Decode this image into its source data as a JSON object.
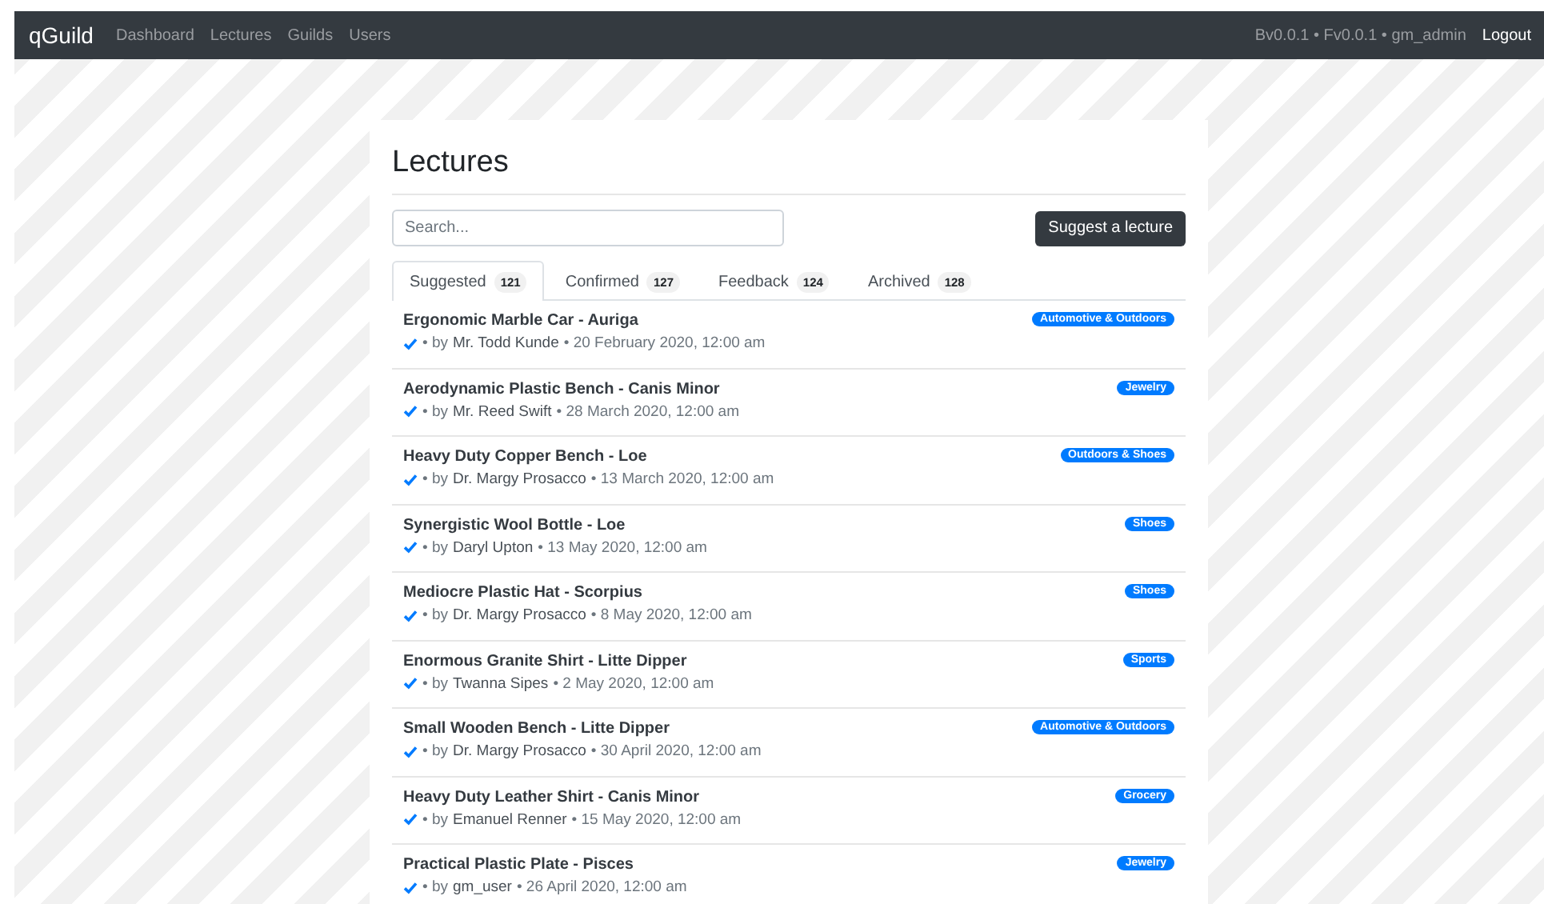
{
  "navbar": {
    "brand": "qGuild",
    "links": [
      "Dashboard",
      "Lectures",
      "Guilds",
      "Users"
    ],
    "version": "Bv0.0.1 • Fv0.0.1 • gm_admin",
    "logout": "Logout"
  },
  "page": {
    "title": "Lectures",
    "search": {
      "placeholder": "Search..."
    },
    "suggest_button": "Suggest a lecture",
    "tabs": [
      {
        "label": "Suggested",
        "count": "121",
        "selected": true
      },
      {
        "label": "Confirmed",
        "count": "127",
        "selected": false
      },
      {
        "label": "Feedback",
        "count": "124",
        "selected": false
      },
      {
        "label": "Archived",
        "count": "128",
        "selected": false
      }
    ],
    "lectures": [
      {
        "title": "Ergonomic Marble Car - Auriga",
        "checked": true,
        "by": "• by",
        "author": "Mr. Todd Kunde",
        "date": "• 20 February 2020, 12:00 am",
        "tag": "Automotive & Outdoors"
      },
      {
        "title": "Aerodynamic Plastic Bench - Canis Minor",
        "checked": true,
        "by": "• by",
        "author": "Mr. Reed Swift",
        "date": "• 28 March 2020, 12:00 am",
        "tag": "Jewelry"
      },
      {
        "title": "Heavy Duty Copper Bench - Loe",
        "checked": true,
        "by": "• by",
        "author": "Dr. Margy Prosacco",
        "date": "• 13 March 2020, 12:00 am",
        "tag": "Outdoors & Shoes"
      },
      {
        "title": "Synergistic Wool Bottle - Loe",
        "checked": true,
        "by": "• by",
        "author": "Daryl Upton",
        "date": "• 13 May 2020, 12:00 am",
        "tag": "Shoes"
      },
      {
        "title": "Mediocre Plastic Hat - Scorpius",
        "checked": true,
        "by": "• by",
        "author": "Dr. Margy Prosacco",
        "date": "• 8 May 2020, 12:00 am",
        "tag": "Shoes"
      },
      {
        "title": "Enormous Granite Shirt - Litte Dipper",
        "checked": true,
        "by": "• by",
        "author": "Twanna Sipes",
        "date": "• 2 May 2020, 12:00 am",
        "tag": "Sports"
      },
      {
        "title": "Small Wooden Bench - Litte Dipper",
        "checked": true,
        "by": "• by",
        "author": "Dr. Margy Prosacco",
        "date": "• 30 April 2020, 12:00 am",
        "tag": "Automotive & Outdoors"
      },
      {
        "title": "Heavy Duty Leather Shirt - Canis Minor",
        "checked": true,
        "by": "• by",
        "author": "Emanuel Renner",
        "date": "• 15 May 2020, 12:00 am",
        "tag": "Grocery"
      },
      {
        "title": "Practical Plastic Plate - Pisces",
        "checked": true,
        "by": "• by",
        "author": "gm_user",
        "date": "• 26 April 2020, 12:00 am",
        "tag": "Jewelry"
      }
    ]
  }
}
